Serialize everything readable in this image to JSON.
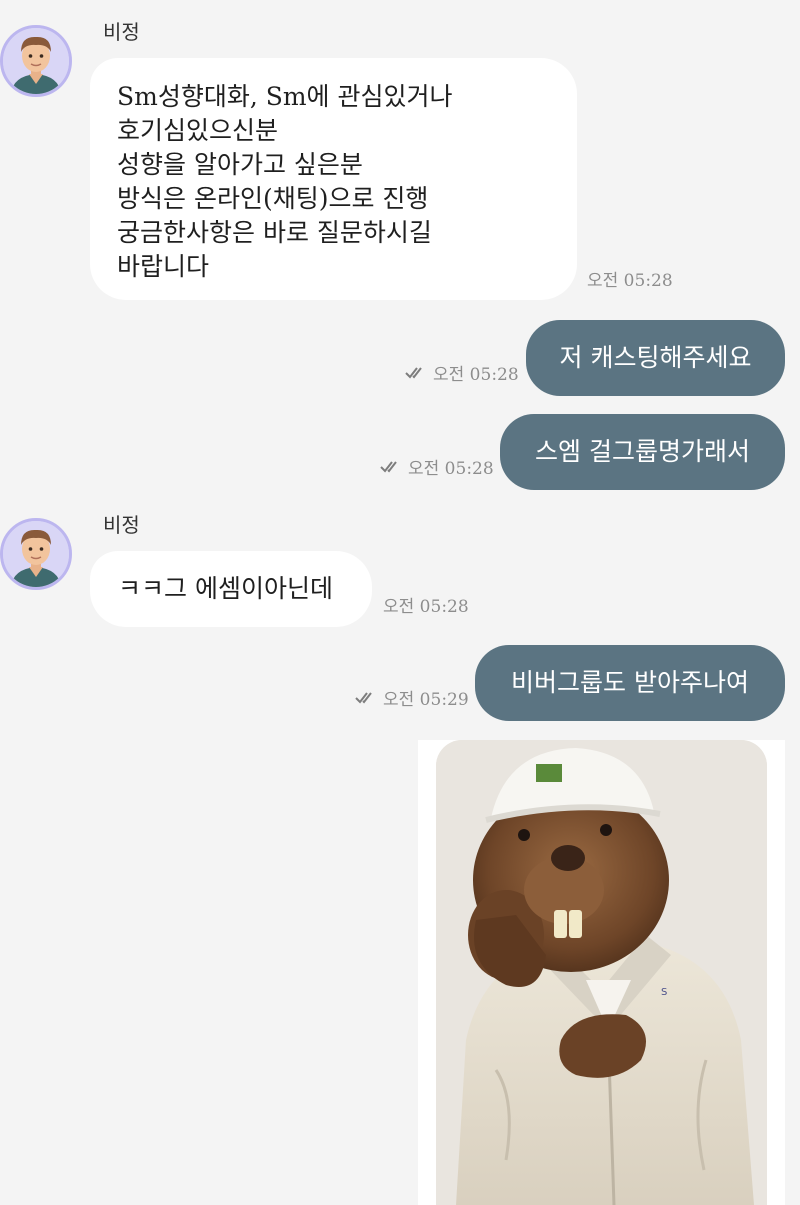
{
  "messages": [
    {
      "type": "incoming",
      "sender": "비정",
      "lines": [
        "Sm성향대화, Sm에 관심있거나",
        "호기심있으신분",
        "성향을 알아가고 싶은분",
        "방식은 온라인(채팅)으로 진행",
        "궁금한사항은 바로 질문하시길",
        "바랍니다"
      ],
      "time": "오전 05:28"
    },
    {
      "type": "outgoing",
      "text": "저 캐스팅해주세요",
      "time": "오전 05:28",
      "status_icon": "double-check-icon"
    },
    {
      "type": "outgoing",
      "text": "스엠 걸그룹명가래서",
      "time": "오전 05:28",
      "status_icon": "double-check-icon"
    },
    {
      "type": "incoming",
      "sender": "비정",
      "lines": [
        "ㅋㅋ그 에셈이아닌데"
      ],
      "time": "오전 05:28"
    },
    {
      "type": "outgoing",
      "text": "비버그룹도 받아주나여",
      "time": "오전 05:29",
      "status_icon": "double-check-icon"
    },
    {
      "type": "outgoing-image",
      "image": "beaver-mascot-photo"
    }
  ],
  "colors": {
    "background": "#f4f4f4",
    "incoming_bubble": "#ffffff",
    "outgoing_bubble": "#5b7482",
    "avatar_bg": "#d9d6f6",
    "timestamp": "#8d8d8d"
  }
}
